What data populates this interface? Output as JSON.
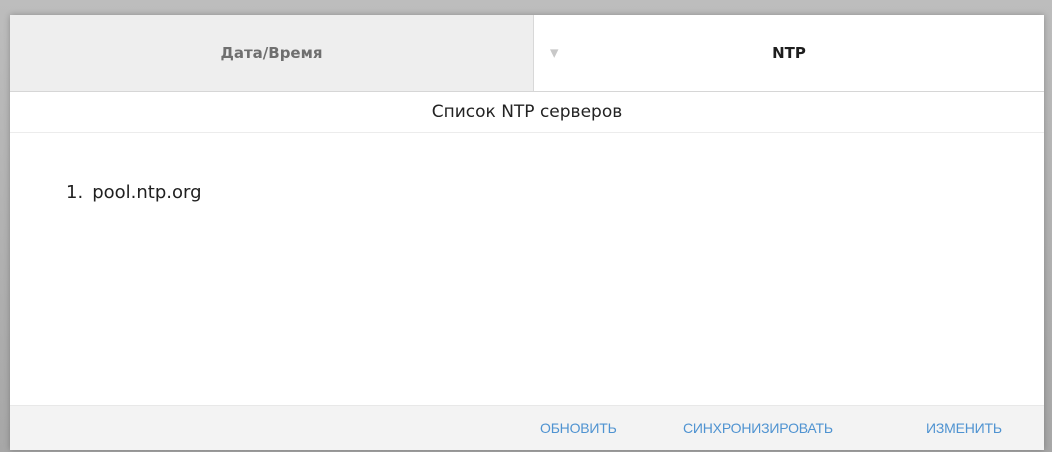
{
  "tabs": [
    {
      "label": "Дата/Время",
      "active": false
    },
    {
      "label": "NTP",
      "active": true
    }
  ],
  "tab_caret": "▼",
  "section_title": "Список NTP серверов",
  "servers": [
    {
      "index": "1.",
      "host": "pool.ntp.org"
    }
  ],
  "actions": {
    "refresh": "ОБНОВИТЬ",
    "sync": "СИНХРОНИЗИРОВАТЬ",
    "edit": "ИЗМЕНИТЬ"
  },
  "colors": {
    "accent_link": "#4f93d1",
    "inactive_tab_bg": "#eeeeee",
    "footer_bg": "#f3f3f3"
  }
}
